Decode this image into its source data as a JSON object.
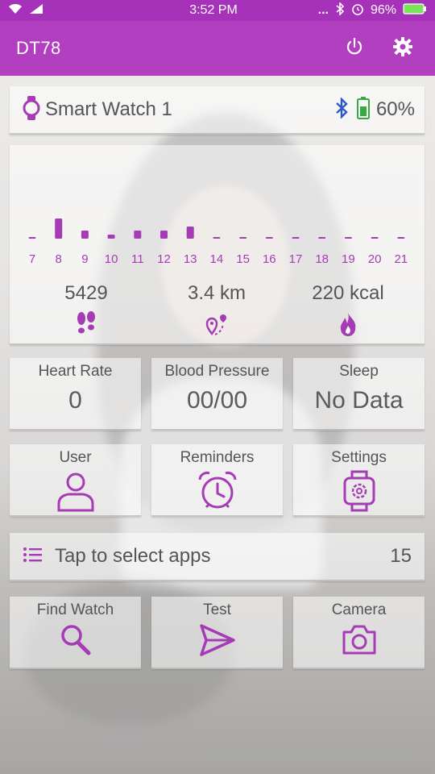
{
  "status_bar": {
    "time": "3:52 PM",
    "battery": "96%",
    "dots": "..."
  },
  "app_bar": {
    "title": "DT78",
    "power_icon": "power-icon",
    "settings_icon": "gear-icon"
  },
  "device": {
    "name": "Smart Watch 1",
    "battery": "60%",
    "icons": [
      "watch-icon",
      "bluetooth-icon",
      "battery-icon"
    ]
  },
  "activity": {
    "chart_data": {
      "type": "bar",
      "categories": [
        "7",
        "8",
        "9",
        "10",
        "11",
        "12",
        "13",
        "14",
        "15",
        "16",
        "17",
        "18",
        "19",
        "20",
        "21"
      ],
      "values": [
        0,
        5,
        2,
        1,
        2,
        2,
        3,
        0,
        0,
        0,
        0,
        0,
        0,
        0,
        0
      ]
    },
    "steps": "5429",
    "distance": "3.4 km",
    "calories": "220 kcal"
  },
  "tiles_row1": [
    {
      "label": "Heart Rate",
      "value": "0"
    },
    {
      "label": "Blood Pressure",
      "value": "00/00"
    },
    {
      "label": "Sleep",
      "value": "No Data"
    }
  ],
  "tiles_row2": [
    {
      "label": "User",
      "icon": "user-icon"
    },
    {
      "label": "Reminders",
      "icon": "alarm-clock-icon"
    },
    {
      "label": "Settings",
      "icon": "watch-settings-icon"
    }
  ],
  "apps": {
    "label": "Tap to select apps",
    "count": "15"
  },
  "tiles_row3": [
    {
      "label": "Find Watch",
      "icon": "search-icon"
    },
    {
      "label": "Test",
      "icon": "send-icon"
    },
    {
      "label": "Camera",
      "icon": "camera-icon"
    }
  ],
  "colors": {
    "accent": "#a53cb5",
    "app_bar": "#b23ec0",
    "status_bar": "#a532b8",
    "bluetooth": "#2f57c8",
    "battery": "#3aa843"
  }
}
